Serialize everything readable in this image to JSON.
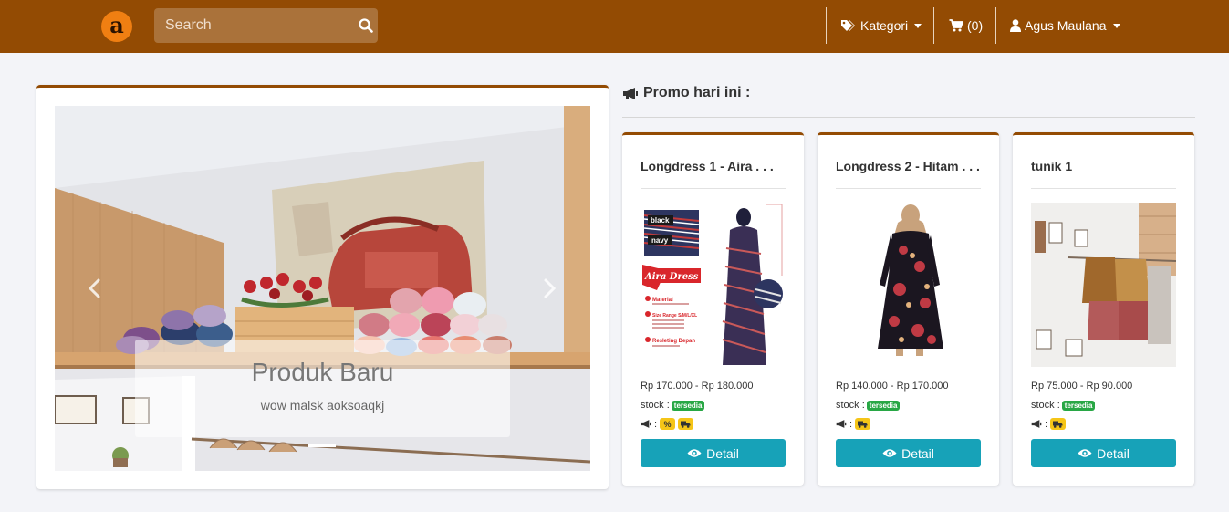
{
  "navbar": {
    "logo_letter": "a",
    "search_placeholder": "Search",
    "kategori_label": "Kategori",
    "cart_label": "(0)",
    "user_label": "Agus Maulana"
  },
  "carousel": {
    "caption_title": "Produk Baru",
    "caption_text": "wow malsk aoksoaqkj"
  },
  "promo": {
    "heading": "Promo hari ini :",
    "products": [
      {
        "title": "Longdress 1 - Aira . . .",
        "price": "Rp 170.000 - Rp 180.000",
        "stock_label": "stock :",
        "stock_status": "tersedia",
        "promo_colon": ":",
        "badges": [
          "%",
          "truck"
        ],
        "image_text": {
          "color1": "black",
          "color2": "navy",
          "brand": "Aira Dress",
          "material": "Material",
          "size": "Size Range S/M/L/XL",
          "resleting": "Resleting Depan"
        },
        "button": "Detail"
      },
      {
        "title": "Longdress 2 - Hitam . . .",
        "price": "Rp 140.000 - Rp 170.000",
        "stock_label": "stock :",
        "stock_status": "tersedia",
        "promo_colon": ":",
        "badges": [
          "truck"
        ],
        "button": "Detail"
      },
      {
        "title": "tunik 1",
        "price": "Rp 75.000 - Rp 90.000",
        "stock_label": "stock :",
        "stock_status": "tersedia",
        "promo_colon": ":",
        "badges": [
          "truck"
        ],
        "button": "Detail"
      }
    ]
  },
  "colors": {
    "navbar": "#934b03",
    "logo": "#f07f12",
    "button": "#17a2b8",
    "badge_green": "#28a745",
    "badge_yellow": "#f5c518"
  }
}
